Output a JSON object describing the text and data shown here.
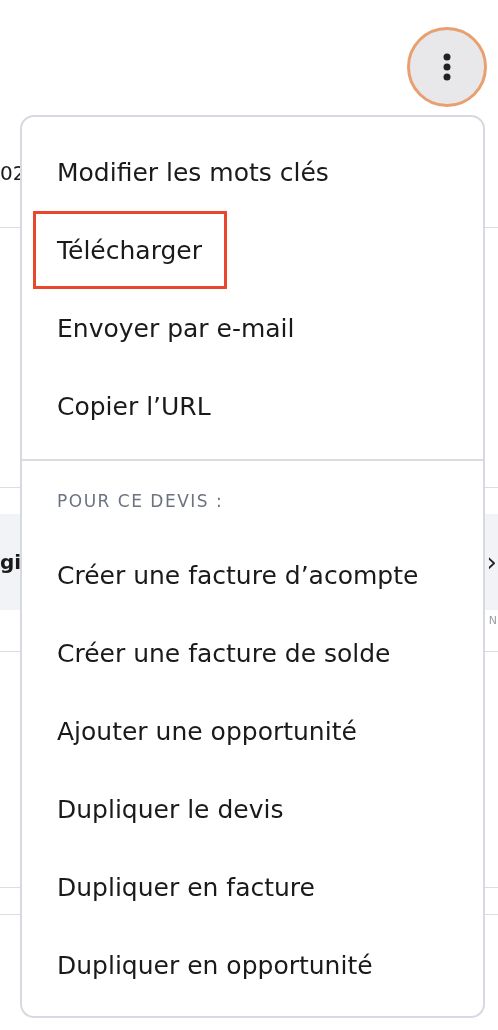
{
  "more_button": {
    "expanded": true
  },
  "background": {
    "row_1": {
      "text": "02"
    },
    "row_2": {
      "text": "gi",
      "chevron": "›",
      "note": "N"
    }
  },
  "menu": {
    "groups": [
      {
        "items": [
          {
            "label": "Modifier les mots clés",
            "highlighted": false
          },
          {
            "label": "Télécharger",
            "highlighted": true
          },
          {
            "label": "Envoyer par e-mail",
            "highlighted": false
          },
          {
            "label": "Copier l’URL",
            "highlighted": false
          }
        ]
      },
      {
        "header": "POUR CE DEVIS :",
        "items": [
          {
            "label": "Créer une facture d’acompte",
            "highlighted": false
          },
          {
            "label": "Créer une facture de solde",
            "highlighted": false
          },
          {
            "label": "Ajouter une opportunité",
            "highlighted": false
          },
          {
            "label": "Dupliquer le devis",
            "highlighted": false
          },
          {
            "label": "Dupliquer en facture",
            "highlighted": false
          },
          {
            "label": "Dupliquer en opportunité",
            "highlighted": false
          }
        ]
      }
    ]
  }
}
